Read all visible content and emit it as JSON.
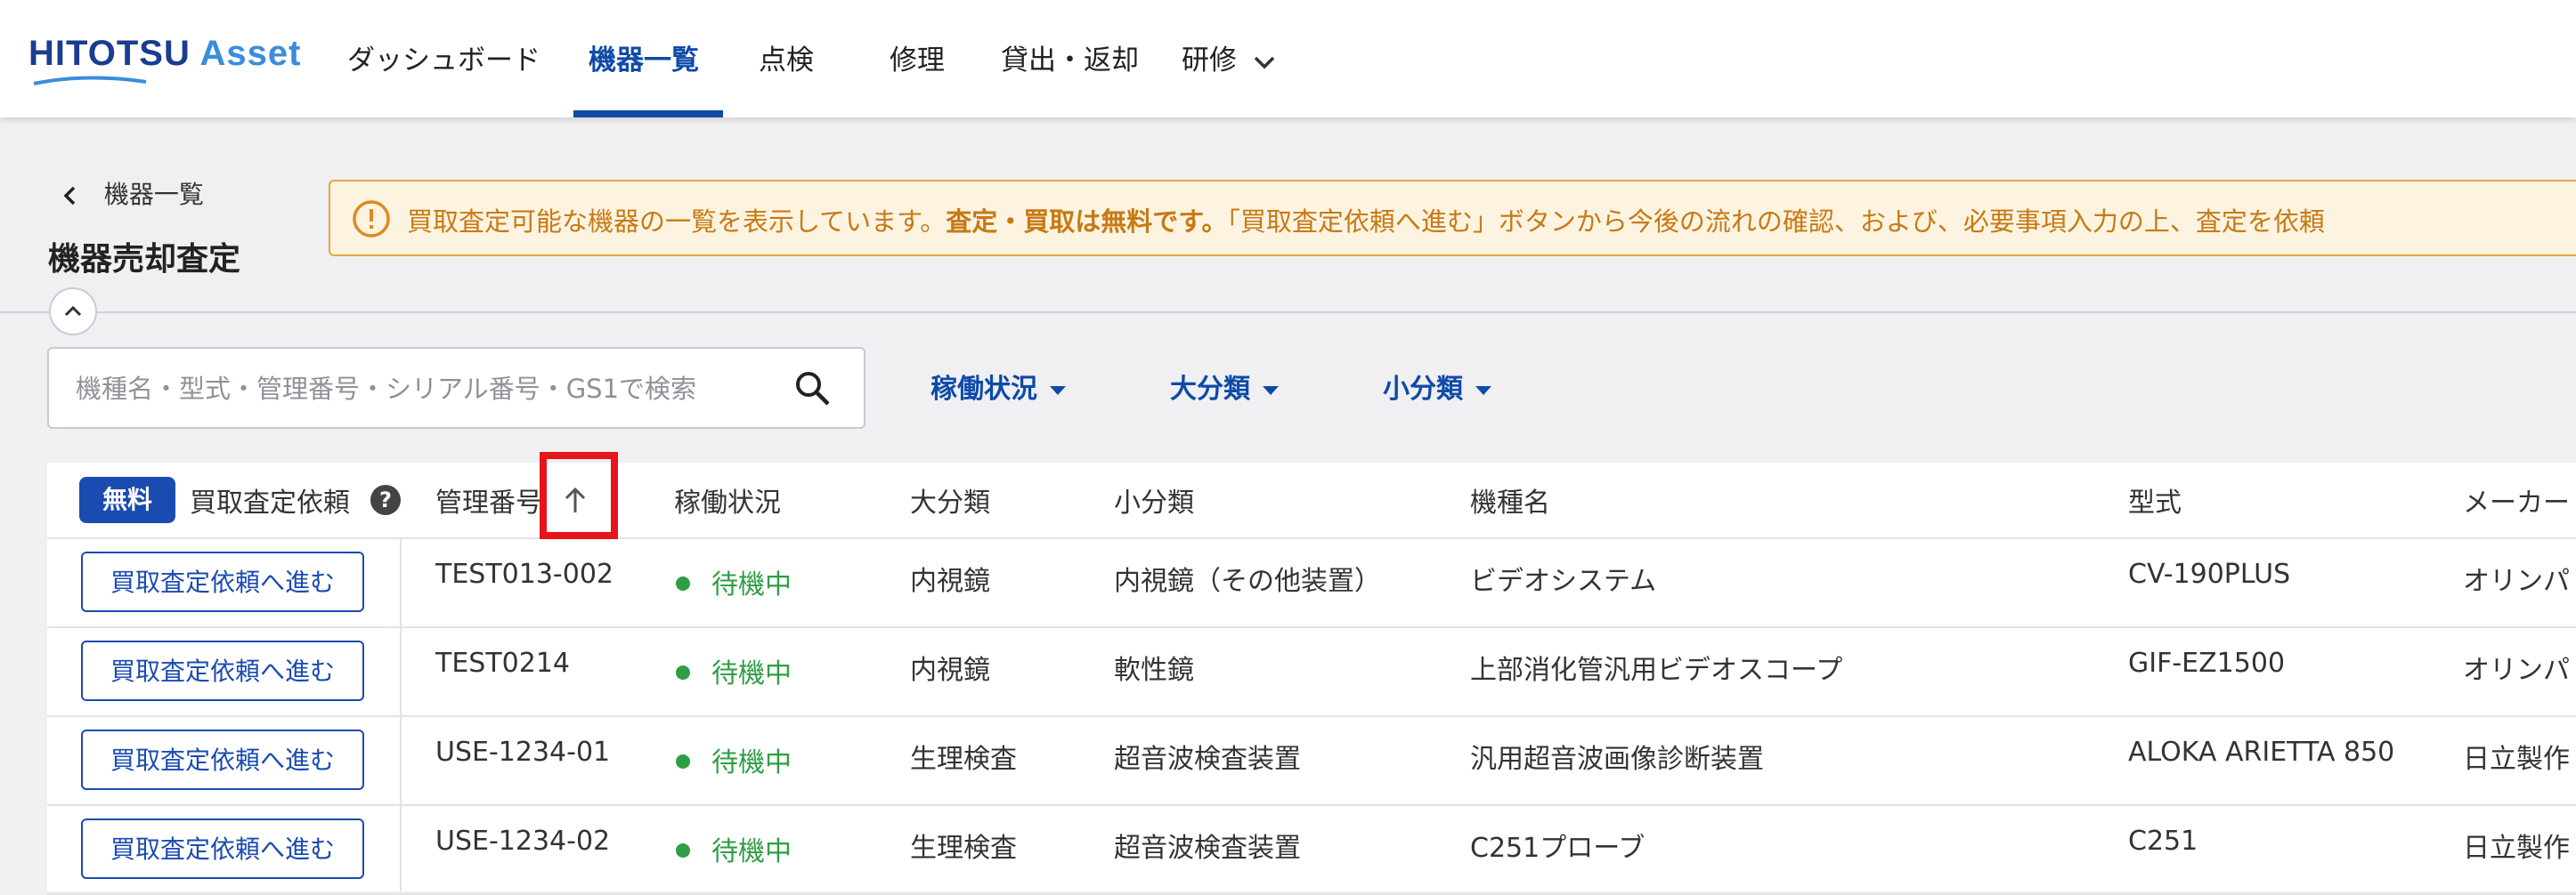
{
  "header": {
    "logo": {
      "primary": "HITOTSU",
      "secondary": "Asset"
    },
    "nav": [
      {
        "label": "ダッシュボード",
        "active": false
      },
      {
        "label": "機器一覧",
        "active": true
      },
      {
        "label": "点検",
        "active": false
      },
      {
        "label": "修理",
        "active": false
      },
      {
        "label": "貸出・返却",
        "active": false
      },
      {
        "label": "研修",
        "active": false,
        "has_dropdown": true
      }
    ]
  },
  "breadcrumb": {
    "back_label": "機器一覧"
  },
  "page": {
    "title": "機器売却査定"
  },
  "notice": {
    "text_1": "買取査定可能な機器の一覧を表示しています。",
    "text_bold": "査定・買取は無料です。",
    "text_2": "「買取査定依頼へ進む」ボタンから今後の流れの確認、および、必要事項入力の上、査定を依頼"
  },
  "search": {
    "placeholder": "機種名・型式・管理番号・シリアル番号・GS1で検索",
    "value": ""
  },
  "filters": [
    "稼働状況",
    "大分類",
    "小分類"
  ],
  "table": {
    "headers": {
      "free_badge": "無料",
      "request": "買取査定依頼",
      "management_no": "管理番号",
      "status": "稼働状況",
      "major": "大分類",
      "minor": "小分類",
      "model_name": "機種名",
      "model": "型式",
      "maker": "メーカー"
    },
    "sort": {
      "column": "management_no",
      "direction": "ascending"
    },
    "rows": [
      {
        "button": "買取査定依頼へ進む",
        "management_no": "TEST013-002",
        "status": "待機中",
        "major": "内視鏡",
        "minor": "内視鏡（その他装置）",
        "model_name": "ビデオシステム",
        "model": "CV-190PLUS",
        "maker": "オリンパ"
      },
      {
        "button": "買取査定依頼へ進む",
        "management_no": "TEST0214",
        "status": "待機中",
        "major": "内視鏡",
        "minor": "軟性鏡",
        "model_name": "上部消化管汎用ビデオスコープ",
        "model": "GIF-EZ1500",
        "maker": "オリンパ"
      },
      {
        "button": "買取査定依頼へ進む",
        "management_no": "USE-1234-01",
        "status": "待機中",
        "major": "生理検査",
        "minor": "超音波検査装置",
        "model_name": "汎用超音波画像診断装置",
        "model": "ALOKA ARIETTA 850",
        "maker": "日立製作"
      },
      {
        "button": "買取査定依頼へ進む",
        "management_no": "USE-1234-02",
        "status": "待機中",
        "major": "生理検査",
        "minor": "超音波検査装置",
        "model_name": "C251プローブ",
        "model": "C251",
        "maker": "日立製作"
      }
    ]
  },
  "colors": {
    "primary": "#0e4aa8",
    "status_green": "#2e9e44",
    "notice_orange": "#c77a12",
    "highlight_red": "#e8141b"
  }
}
